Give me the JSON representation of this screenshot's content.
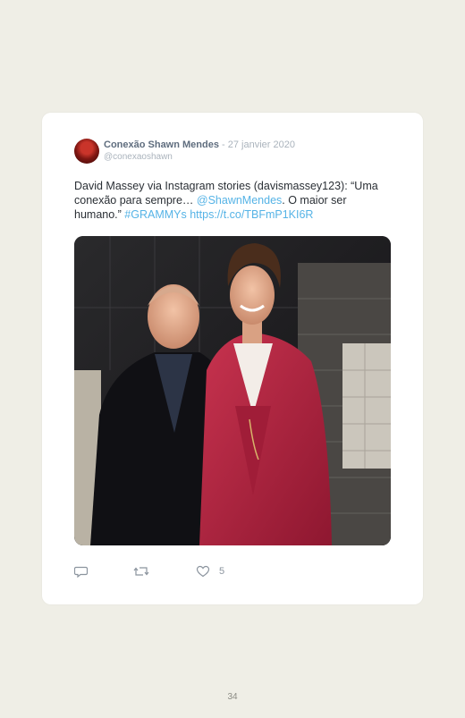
{
  "tweet": {
    "author_name": "Conexão Shawn Mendes",
    "separator": " - ",
    "date": "27 janvier 2020",
    "handle": "@conexaoshawn",
    "text_part1": "David Massey via Instagram stories (davismassey123): “Uma conexão para sempre… ",
    "mention": "@ShawnMendes",
    "text_part2": ". O maior ser humano.” ",
    "hashtag": "#GRAMMYs",
    "url_text": "https://t.co/TBFmP1KI6R",
    "likes": "5"
  },
  "icons": {
    "reply": "reply-icon",
    "retweet": "retweet-icon",
    "like": "heart-icon"
  },
  "colors": {
    "link": "#55b3e6",
    "author": "#5f6d7e",
    "muted": "#aab3bc",
    "page_background": "#efeee6"
  },
  "page_number": "34"
}
